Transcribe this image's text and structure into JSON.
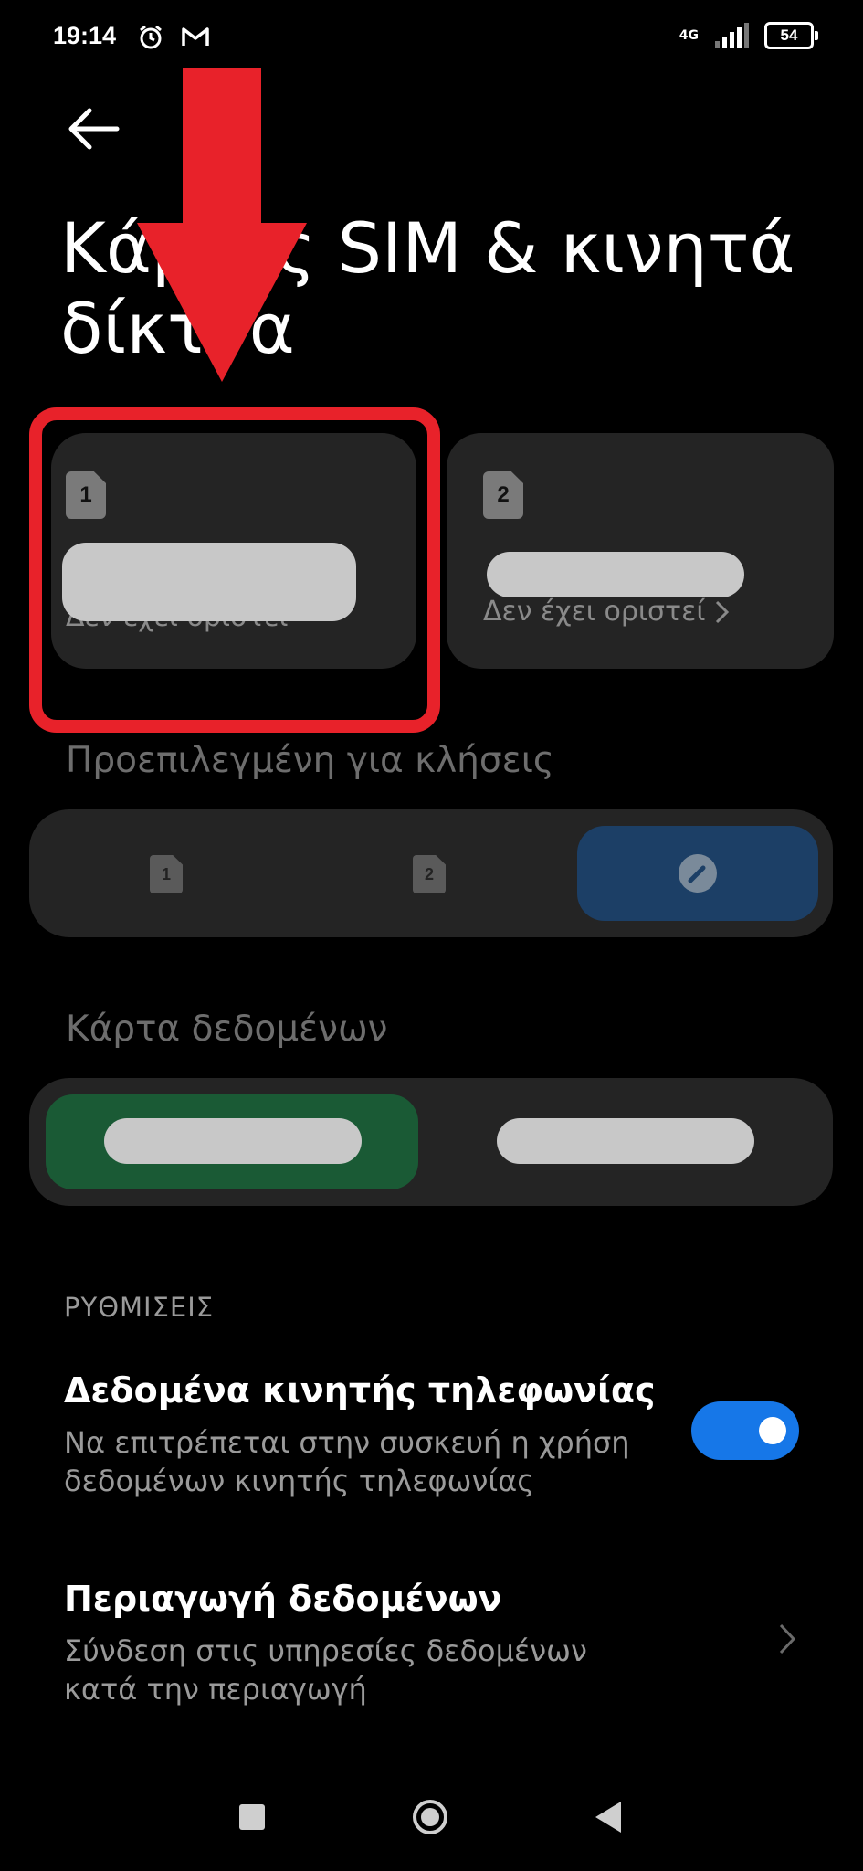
{
  "status_bar": {
    "time": "19:14",
    "network": "4G",
    "battery": "54"
  },
  "header": {
    "title": "Κάρτες SIM & κινητά δίκτυα"
  },
  "sim_cards": [
    {
      "number": "1",
      "status": "Δεν έχει οριστεί"
    },
    {
      "number": "2",
      "status": "Δεν έχει οριστεί"
    }
  ],
  "calls": {
    "label": "Προεπιλεγμένη για κλήσεις",
    "options": [
      "1",
      "2"
    ]
  },
  "data_card": {
    "label": "Κάρτα δεδομένων"
  },
  "settings": {
    "heading": "ΡΥΘΜΙΣΕΙΣ",
    "mobile_data": {
      "title": "Δεδομένα κινητής τηλεφωνίας",
      "description": "Να επιτρέπεται στην συσκευή η χρήση δεδομένων κινητής τηλεφωνίας",
      "enabled": true
    },
    "roaming": {
      "title": "Περιαγωγή δεδομένων",
      "description": "Σύνδεση στις υπηρεσίες δεδομένων κατά την περιαγωγή"
    }
  },
  "colors": {
    "accent_blue": "#1677e8",
    "annotation_red": "#e8222a",
    "data_selected": "#1a5a35"
  }
}
